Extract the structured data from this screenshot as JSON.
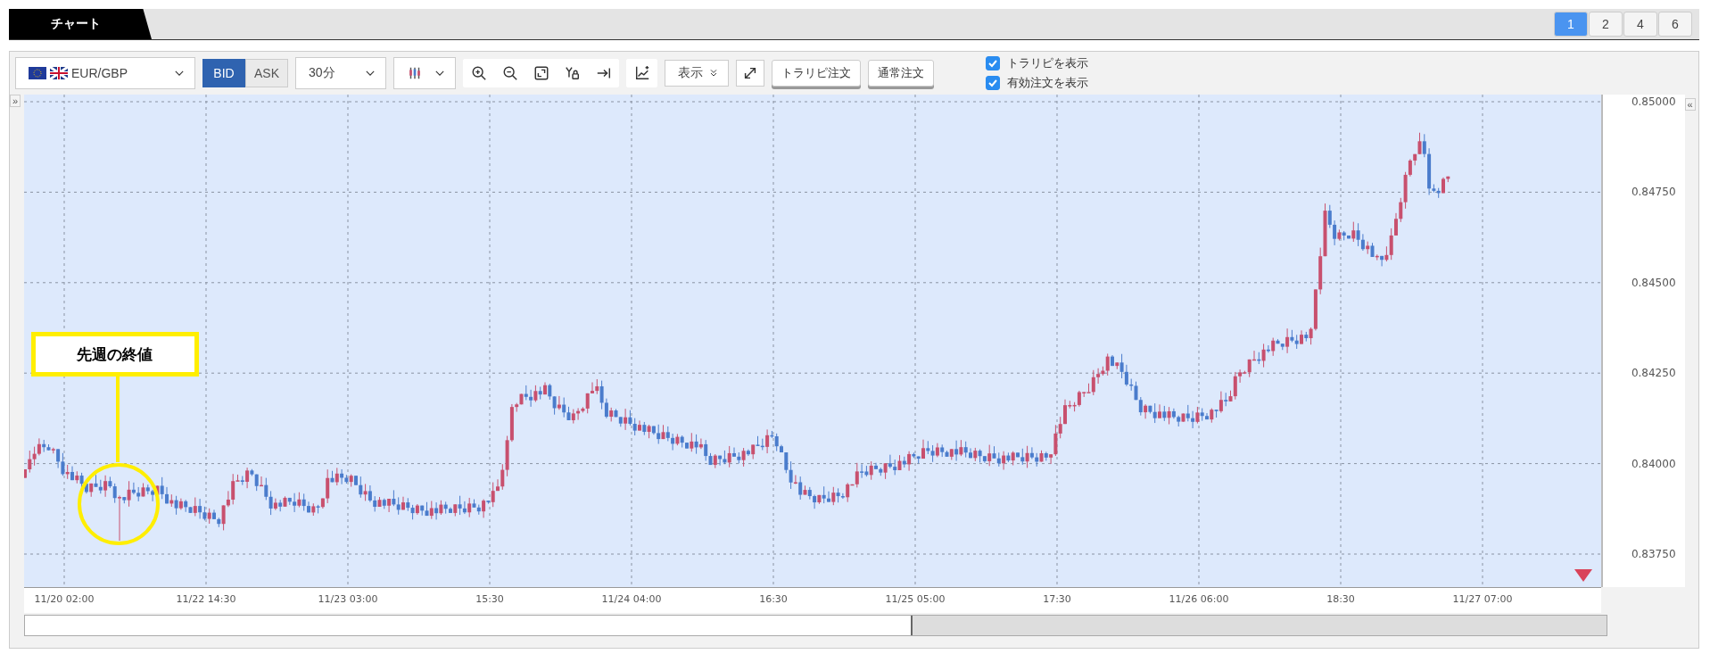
{
  "tab": {
    "label": "チャート"
  },
  "layout_buttons": [
    {
      "label": "1",
      "selected": true
    },
    {
      "label": "2",
      "selected": false
    },
    {
      "label": "4",
      "selected": false
    },
    {
      "label": "6",
      "selected": false
    }
  ],
  "toolbar": {
    "symbol": "EUR/GBP",
    "price_sides": [
      {
        "label": "BID",
        "selected": true
      },
      {
        "label": "ASK",
        "selected": false
      }
    ],
    "timeframe": "30分",
    "display_menu": "表示",
    "order_buttons": [
      "トラリピ注文",
      "通常注文"
    ],
    "checkboxes": [
      {
        "label": "トラリピを表示",
        "checked": true
      },
      {
        "label": "有効注文を表示",
        "checked": true
      }
    ]
  },
  "chart": {
    "left_toggle": "»",
    "right_toggle": "«",
    "annotation": "先週の終値",
    "y_labels": [
      "0.85000",
      "0.84750",
      "0.84500",
      "0.84250",
      "0.84000",
      "0.83750"
    ],
    "x_labels": [
      "11/20 02:00",
      "11/22 14:30",
      "11/23 03:00",
      "15:30",
      "11/24 04:00",
      "16:30",
      "11/25 05:00",
      "17:30",
      "11/26 06:00",
      "18:30",
      "11/27 07:00"
    ]
  }
}
